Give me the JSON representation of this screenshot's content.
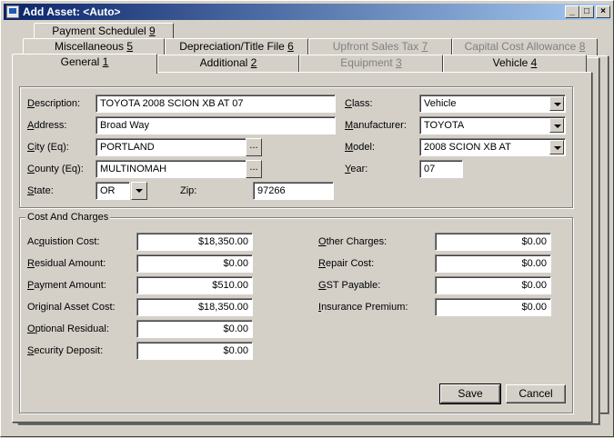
{
  "window": {
    "title": "Add Asset: <Auto>",
    "minimize": "_",
    "maximize": "□",
    "close": "×"
  },
  "tabs": {
    "row3": [
      {
        "label": "Payment Schedulel ",
        "key": "9",
        "disabled": false
      }
    ],
    "row2": [
      {
        "label": "Miscellaneous ",
        "key": "5",
        "disabled": false
      },
      {
        "label": "Depreciation/Title File ",
        "key": "6",
        "disabled": false
      },
      {
        "label": "Upfront Sales Tax ",
        "key": "7",
        "disabled": true
      },
      {
        "label": "Capital Cost Allowance ",
        "key": "8",
        "disabled": true
      }
    ],
    "row1": [
      {
        "label": "General ",
        "key": "1",
        "disabled": false,
        "active": true
      },
      {
        "label": "Additional ",
        "key": "2",
        "disabled": false
      },
      {
        "label": "Equipment ",
        "key": "3",
        "disabled": true
      },
      {
        "label": "Vehicle ",
        "key": "4",
        "disabled": false
      }
    ]
  },
  "asset": {
    "description_label_key": "D",
    "description_label_rest": "escription:",
    "description_value": "TOYOTA 2008 SCION XB AT 07",
    "address_label_key": "A",
    "address_label_rest": "ddress:",
    "address_value": "Broad Way",
    "city_label_key": "C",
    "city_label_rest": "ity (Eq):",
    "city_value": "PORTLAND",
    "county_label_key": "C",
    "county_label_rest": "ounty (Eq):",
    "county_value": "MULTINOMAH",
    "state_label_key": "S",
    "state_label_rest": "tate:",
    "state_value": "OR",
    "zip_label": "Zip:",
    "zip_value": "97266",
    "class_label_key": "C",
    "class_label_rest": "lass:",
    "class_value": "Vehicle",
    "manufacturer_label_key": "M",
    "manufacturer_label_rest": "anufacturer:",
    "manufacturer_value": "TOYOTA",
    "model_label_key": "M",
    "model_label_rest": "odel:",
    "model_value": "2008 SCION XB AT",
    "year_label_key": "Y",
    "year_label_rest": "ear:",
    "year_value": "07",
    "ellipsis": "..."
  },
  "costs": {
    "group_title": "Cost And Charges",
    "acquisition_label_pre": "Ac",
    "acquisition_label_key": "q",
    "acquisition_label_rest": "uistion Cost:",
    "acquisition_value": "$18,350.00",
    "residual_label_key": "R",
    "residual_label_rest": "esidual Amount:",
    "residual_value": "$0.00",
    "payment_label_key": "P",
    "payment_label_rest": "ayment Amount:",
    "payment_value": "$510.00",
    "original_label": "Original Asset Cost:",
    "original_value": "$18,350.00",
    "optional_label_key": "O",
    "optional_label_rest": "ptional Residual:",
    "optional_value": "$0.00",
    "security_label_key": "S",
    "security_label_rest": "ecurity Deposit:",
    "security_value": "$0.00",
    "other_label_key": "O",
    "other_label_rest": "ther Charges:",
    "other_value": "$0.00",
    "repair_label_key": "R",
    "repair_label_rest": "epair Cost:",
    "repair_value": "$0.00",
    "gst_label_key": "G",
    "gst_label_rest": "ST Payable:",
    "gst_value": "$0.00",
    "insurance_label_key": "I",
    "insurance_label_rest": "nsurance Premium:",
    "insurance_value": "$0.00"
  },
  "buttons": {
    "save": "Save",
    "cancel": "Cancel"
  }
}
